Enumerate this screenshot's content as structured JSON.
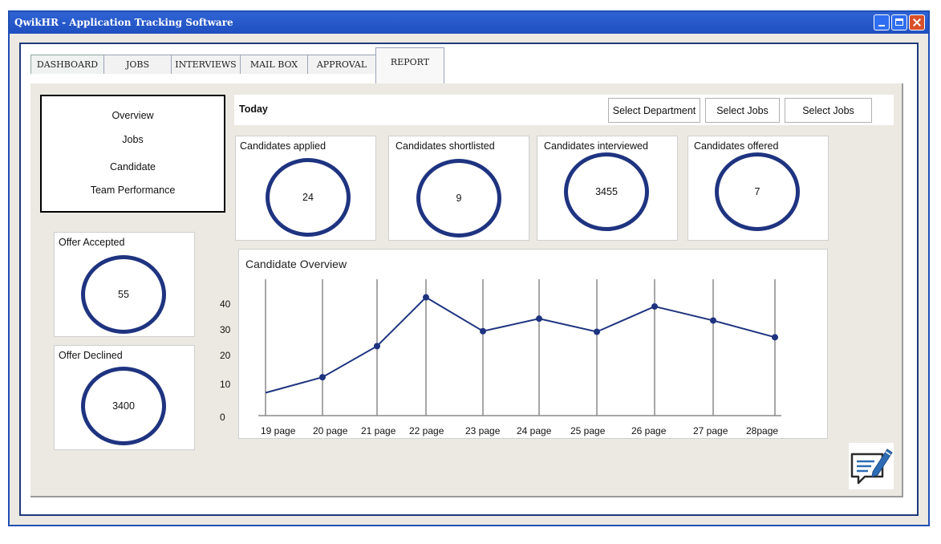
{
  "window": {
    "title": "QwikHR - Application Tracking Software"
  },
  "tabs": [
    "DASHBOARD",
    "JOBS",
    "INTERVIEWS",
    "MAIL BOX",
    "APPROVAL",
    "REPORT"
  ],
  "active_tab": "REPORT",
  "side_menu": [
    "Overview",
    "Jobs",
    "Candidate",
    "Team Performance"
  ],
  "toolbar": {
    "today_label": "Today",
    "select_department": "Select Department",
    "select_jobs_1": "Select Jobs",
    "select_jobs_2": "Select Jobs"
  },
  "stats": [
    {
      "label": "Candidates applied",
      "value": "24"
    },
    {
      "label": "Candidates shortlisted",
      "value": "9"
    },
    {
      "label": "Candidates interviewed",
      "value": "3455"
    },
    {
      "label": "Candidates offered",
      "value": "7"
    }
  ],
  "offers": [
    {
      "label": "Offer Accepted",
      "value": "55"
    },
    {
      "label": "Offer Declined",
      "value": "3400"
    }
  ],
  "colors": {
    "accent": "#1f3480",
    "titlebar": "#1f4fc0",
    "panel": "#ece9e2"
  },
  "icons": {
    "notes": "edit-note-icon"
  },
  "chart_data": {
    "type": "line",
    "title": "Candidate Overview",
    "categories": [
      "19 page",
      "20 page",
      "21 page",
      "22  page",
      "23 page",
      "24 page",
      "25  page",
      "26 page",
      "27 page",
      "28page"
    ],
    "values": [
      7.5,
      12.6,
      22.8,
      38.8,
      27.7,
      31.8,
      27.5,
      35.8,
      31.2,
      25.7
    ],
    "yticks": [
      "0",
      "10",
      "20",
      "30",
      "40"
    ],
    "ylim": [
      0,
      40
    ]
  }
}
